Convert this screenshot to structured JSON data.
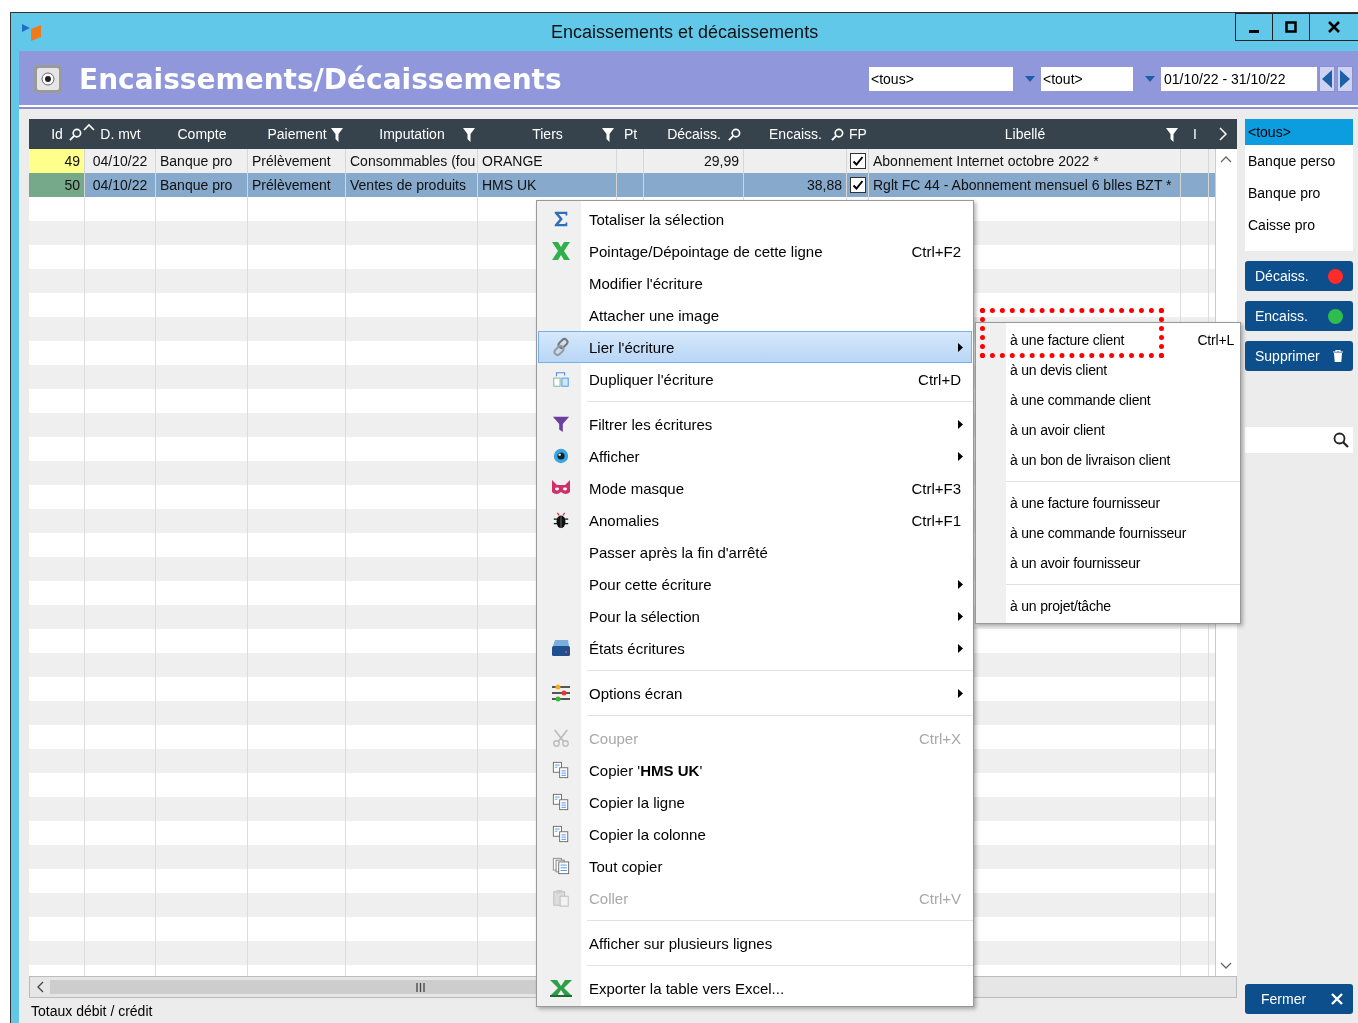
{
  "window": {
    "title": "Encaissements et décaissements"
  },
  "header": {
    "title": "Encaissements/Décaissements",
    "filter_1": {
      "value": "<tous>"
    },
    "filter_2": {
      "value": "<tout>"
    },
    "period": {
      "value": "01/10/22 - 31/10/22"
    }
  },
  "table": {
    "columns": [
      {
        "label": "Id",
        "searchable": true
      },
      {
        "label": "D. mvt",
        "sorted": true
      },
      {
        "label": "Compte"
      },
      {
        "label": "Paiement",
        "filterable": true
      },
      {
        "label": "Imputation",
        "filterable": true
      },
      {
        "label": "Tiers",
        "filterable": true
      },
      {
        "label": "Pt"
      },
      {
        "label": "Décaiss.",
        "searchable": true
      },
      {
        "label": "Encaiss.",
        "searchable": true
      },
      {
        "label": "FP"
      },
      {
        "label": "Libellé",
        "filterable": true
      },
      {
        "label": "I"
      }
    ],
    "rows": [
      {
        "id": "49",
        "color": "#ffff8c",
        "date": "04/10/22",
        "compte": "Banque pro",
        "paiement": "Prélèvement",
        "imputation": "Consommables (fou",
        "tiers": "ORANGE",
        "decaiss": "29,99",
        "fp_checked": true,
        "libelle": "Abonnement Internet octobre 2022 *",
        "selected": false
      },
      {
        "id": "50",
        "color": "#76a88a",
        "date": "04/10/22",
        "compte": "Banque pro",
        "paiement": "Prélèvement",
        "imputation": "Ventes de produits",
        "tiers": "HMS UK",
        "encaiss": "38,88",
        "fp_checked": true,
        "libelle": "Rglt FC 44 - Abonnement mensuel 6 blles BZT *",
        "selected": true
      }
    ],
    "footer": "Totaux débit / crédit"
  },
  "side_panel": {
    "accounts": [
      {
        "label": "<tous>",
        "selected": true
      },
      {
        "label": "Banque perso",
        "selected": false
      },
      {
        "label": "Banque pro",
        "selected": false
      },
      {
        "label": "Caisse pro",
        "selected": false
      }
    ],
    "buttons": [
      {
        "label": "Décaiss.",
        "kind": "dot",
        "color": "#ff2a2a"
      },
      {
        "label": "Encaiss.",
        "kind": "dot",
        "color": "#2ebd4e"
      },
      {
        "label": "Supprimer",
        "kind": "delete"
      }
    ],
    "close_button": "Fermer"
  },
  "context_menu": {
    "items": [
      {
        "kind": "item",
        "label": "Totaliser la sélection",
        "submenu": false,
        "disabled": false,
        "selected": false
      },
      {
        "kind": "item",
        "label": "Pointage/Dépointage de cette ligne",
        "shortcut": "Ctrl+F2",
        "submenu": false,
        "disabled": false,
        "selected": false
      },
      {
        "kind": "item",
        "label": "Modifier l'écriture",
        "submenu": false,
        "disabled": false,
        "selected": false
      },
      {
        "kind": "item",
        "label": "Attacher une image",
        "submenu": false,
        "disabled": false,
        "selected": false
      },
      {
        "kind": "item",
        "label": "Lier l'écriture",
        "submenu": true,
        "disabled": false,
        "selected": true
      },
      {
        "kind": "item",
        "label": "Dupliquer l'écriture",
        "shortcut": "Ctrl+D",
        "submenu": false,
        "disabled": false,
        "selected": false
      },
      {
        "kind": "separator"
      },
      {
        "kind": "item",
        "label": "Filtrer les écritures",
        "submenu": true,
        "disabled": false,
        "selected": false
      },
      {
        "kind": "item",
        "label": "Afficher",
        "submenu": true,
        "disabled": false,
        "selected": false
      },
      {
        "kind": "item",
        "label": "Mode masque",
        "shortcut": "Ctrl+F3",
        "submenu": false,
        "disabled": false,
        "selected": false
      },
      {
        "kind": "item",
        "label": "Anomalies",
        "shortcut": "Ctrl+F1",
        "submenu": false,
        "disabled": false,
        "selected": false
      },
      {
        "kind": "item",
        "label": "Passer après la fin d'arrêté",
        "submenu": false,
        "disabled": false,
        "selected": false
      },
      {
        "kind": "item",
        "label": "Pour cette écriture",
        "submenu": true,
        "disabled": false,
        "selected": false
      },
      {
        "kind": "item",
        "label": "Pour la sélection",
        "submenu": true,
        "disabled": false,
        "selected": false
      },
      {
        "kind": "item",
        "label": "États écritures",
        "submenu": true,
        "disabled": false,
        "selected": false
      },
      {
        "kind": "separator"
      },
      {
        "kind": "item",
        "label": "Options écran",
        "submenu": true,
        "disabled": false,
        "selected": false
      },
      {
        "kind": "separator"
      },
      {
        "kind": "item",
        "label": "Couper",
        "shortcut": "Ctrl+X",
        "submenu": false,
        "disabled": true,
        "selected": false
      },
      {
        "kind": "item",
        "label": "Copier '**HMS UK**'",
        "submenu": false,
        "disabled": false,
        "selected": false
      },
      {
        "kind": "item",
        "label": "Copier la ligne",
        "submenu": false,
        "disabled": false,
        "selected": false
      },
      {
        "kind": "item",
        "label": "Copier la colonne",
        "submenu": false,
        "disabled": false,
        "selected": false
      },
      {
        "kind": "item",
        "label": "Tout copier",
        "submenu": false,
        "disabled": false,
        "selected": false
      },
      {
        "kind": "item",
        "label": "Coller",
        "shortcut": "Ctrl+V",
        "submenu": false,
        "disabled": true,
        "selected": false
      },
      {
        "kind": "separator"
      },
      {
        "kind": "item",
        "label": "Afficher sur plusieurs lignes",
        "submenu": false,
        "disabled": false,
        "selected": false
      },
      {
        "kind": "separator"
      },
      {
        "kind": "item",
        "label": "Exporter la table vers Excel...",
        "submenu": false,
        "disabled": false,
        "selected": false
      }
    ]
  },
  "submenu": {
    "items": [
      {
        "kind": "item",
        "label": "à une facture client",
        "shortcut": "Ctrl+L"
      },
      {
        "kind": "item",
        "label": "à un devis client"
      },
      {
        "kind": "item",
        "label": "à une commande client"
      },
      {
        "kind": "item",
        "label": "à un avoir client"
      },
      {
        "kind": "item",
        "label": "à un bon de livraison client"
      },
      {
        "kind": "separator"
      },
      {
        "kind": "item",
        "label": "à une facture fournisseur"
      },
      {
        "kind": "item",
        "label": "à une commande fournisseur"
      },
      {
        "kind": "item",
        "label": "à un avoir fournisseur"
      },
      {
        "kind": "separator"
      },
      {
        "kind": "item",
        "label": "à un projet/tâche"
      }
    ]
  }
}
